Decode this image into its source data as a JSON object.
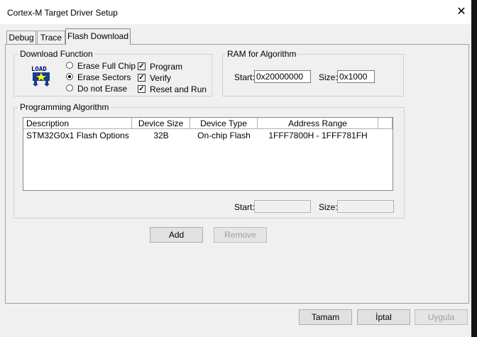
{
  "window": {
    "title": "Cortex-M Target Driver Setup"
  },
  "tabs": [
    {
      "label": "Debug"
    },
    {
      "label": "Trace"
    },
    {
      "label": "Flash Download"
    }
  ],
  "download_function": {
    "group_label": "Download Function",
    "load_icon_text": "LOAD",
    "options": [
      {
        "label": "Erase Full Chip",
        "selected": false
      },
      {
        "label": "Erase Sectors",
        "selected": true
      },
      {
        "label": "Do not Erase",
        "selected": false
      }
    ],
    "checks": [
      {
        "label": "Program",
        "checked": true
      },
      {
        "label": "Verify",
        "checked": true
      },
      {
        "label": "Reset and Run",
        "checked": true
      }
    ]
  },
  "ram": {
    "group_label": "RAM for Algorithm",
    "start_label": "Start:",
    "start_value": "0x20000000",
    "size_label": "Size:",
    "size_value": "0x1000"
  },
  "programming": {
    "group_label": "Programming Algorithm",
    "columns": [
      "Description",
      "Device Size",
      "Device Type",
      "Address Range"
    ],
    "rows": [
      {
        "description": "STM32G0x1 Flash Options",
        "device_size": "32B",
        "device_type": "On-chip Flash",
        "address_range": "1FFF7800H - 1FFF781FH"
      }
    ],
    "start_label": "Start:",
    "start_value": "",
    "size_label": "Size:",
    "size_value": "",
    "add_label": "Add",
    "remove_label": "Remove"
  },
  "footer": {
    "ok_label": "Tamam",
    "cancel_label": "İptal",
    "apply_label": "Uygula"
  }
}
